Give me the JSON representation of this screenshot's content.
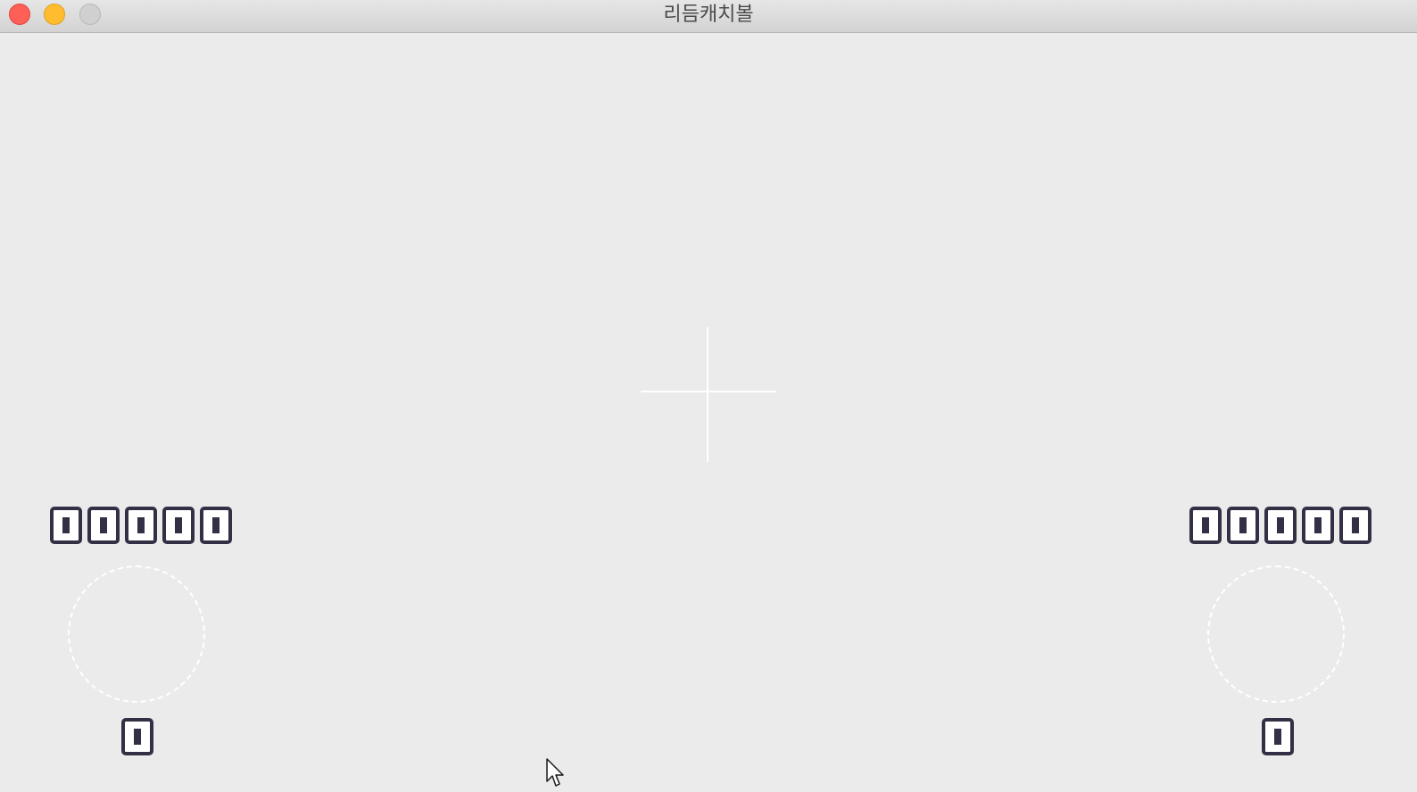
{
  "window": {
    "title": "리듬캐치볼"
  },
  "controls": {
    "close": "close-icon",
    "minimize": "minimize-icon",
    "zoom": "zoom-icon"
  },
  "colors": {
    "background": "#ebebeb",
    "digit_border": "#342f45",
    "close": "#fe5f57",
    "minimize": "#febc2e",
    "zoom_disabled": "#d0d0d0",
    "accent_lines": "#ffffff"
  },
  "player_left": {
    "score_digits": [
      "0",
      "0",
      "0",
      "0",
      "0"
    ],
    "combo_digits": [
      "0"
    ]
  },
  "player_right": {
    "score_digits": [
      "0",
      "0",
      "0",
      "0",
      "0"
    ],
    "combo_digits": [
      "0"
    ]
  },
  "icons": {
    "crosshair": "crosshair-icon",
    "cursor": "mouse-pointer-icon"
  }
}
